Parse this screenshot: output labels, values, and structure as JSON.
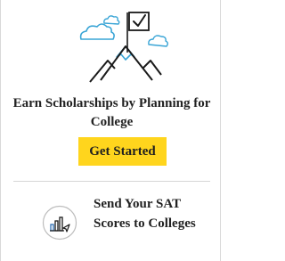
{
  "promo": {
    "illustration_icon": "mountain-flag-checkbox-illustration",
    "headline": "Earn Scholarships by Planning for College",
    "cta_label": "Get Started"
  },
  "sat_link": {
    "icon": "bar-chart-send-icon",
    "label": "Send Your SAT Scores to Colleges"
  },
  "colors": {
    "cta_background": "#ffd51d",
    "illustration_blue": "#3aa5d6",
    "icon_blue": "#2f6fb3",
    "text": "#222222",
    "divider": "#d6d6d6"
  }
}
